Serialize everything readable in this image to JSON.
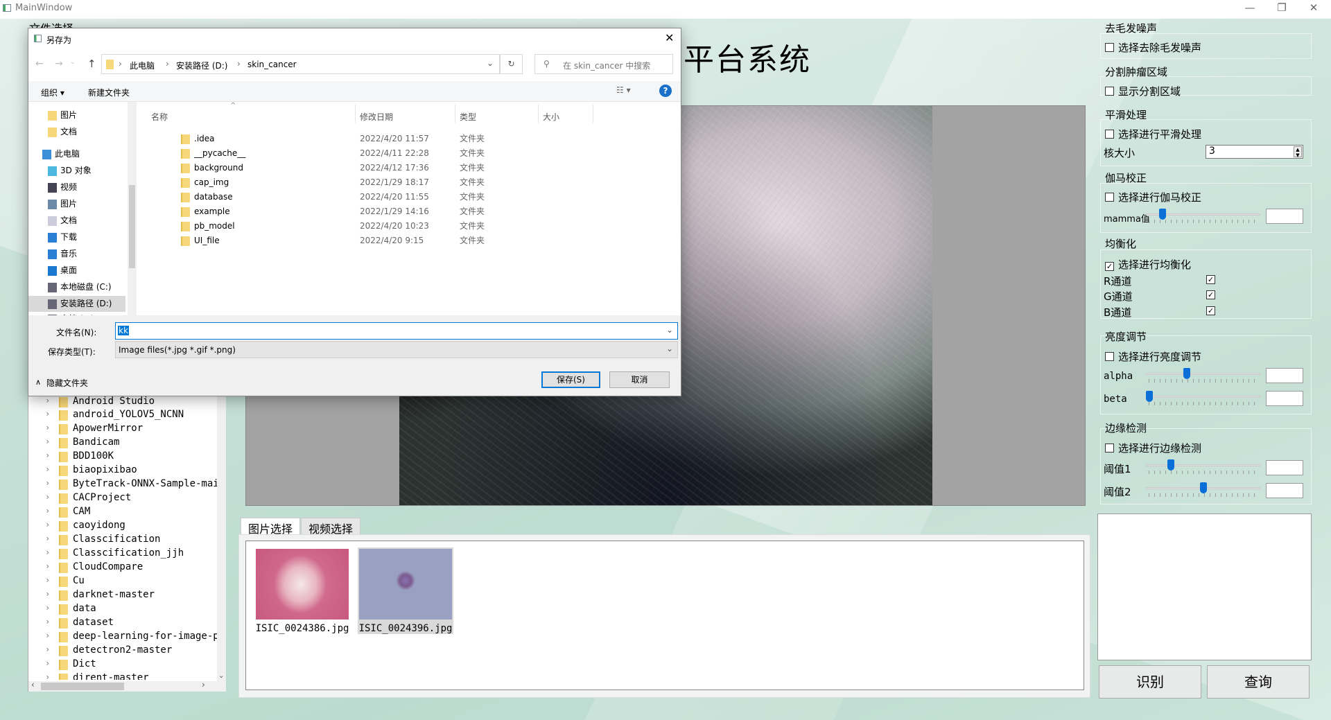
{
  "window": {
    "title": "MainWindow",
    "minimize": "—",
    "restore": "❐",
    "close": "✕"
  },
  "app": {
    "title_visible": "平台系统",
    "file_select_label": "文件选择",
    "tabs": [
      {
        "label": "图片选择",
        "active": true
      },
      {
        "label": "视频选择",
        "active": false
      }
    ],
    "thumbnails": [
      {
        "name": "ISIC_0024386.jpg",
        "selected": false
      },
      {
        "name": "ISIC_0024396.jpg",
        "selected": true
      }
    ],
    "tree_items": [
      "android_YOLOV5_NCNN",
      "ApowerMirror",
      "Bandicam",
      "BDD100K",
      "biaopixibao",
      "ByteTrack-ONNX-Sample-main",
      "CACProject",
      "CAM",
      "caoyidong",
      "Classcification",
      "Classcification_jjh",
      "CloudCompare",
      "Cu",
      "darknet-master",
      "data",
      "dataset",
      "deep-learning-for-image-processing",
      "detectron2-master",
      "Dict",
      "dirent-master"
    ],
    "tree_partial": "Android Studio",
    "buttons": {
      "recognize": "识别",
      "query": "查询"
    }
  },
  "right_panel": {
    "hair": {
      "title": "去毛发噪声",
      "checkbox": "选择去除毛发噪声",
      "checked": false
    },
    "segment": {
      "title": "分割肿瘤区域",
      "checkbox": "显示分割区域",
      "checked": false
    },
    "smooth": {
      "title": "平滑处理",
      "checkbox": "选择进行平滑处理",
      "checked": false,
      "kernel_label": "核大小",
      "kernel_value": "3"
    },
    "gamma": {
      "title": "伽马校正",
      "checkbox": "选择进行伽马校正",
      "checked": false,
      "slider_label": "mamma值",
      "slider_percent": 12,
      "value": ""
    },
    "equalize": {
      "title": "均衡化",
      "checkbox": "选择进行均衡化",
      "checked": true,
      "channels": [
        {
          "label": "R通道",
          "checked": true
        },
        {
          "label": "G通道",
          "checked": true
        },
        {
          "label": "B通道",
          "checked": true
        }
      ]
    },
    "brightness": {
      "title": "亮度调节",
      "checkbox": "选择进行亮度调节",
      "checked": false,
      "alpha_label": "alpha",
      "alpha_percent": 35,
      "alpha_value": "",
      "beta_label": "beta",
      "beta_percent": 0,
      "beta_value": ""
    },
    "edge": {
      "title": "边缘检测",
      "checkbox": "选择进行边缘检测",
      "checked": false,
      "t1_label": "阈值1",
      "t1_percent": 20,
      "t1_value": "",
      "t2_label": "阈值2",
      "t2_percent": 50,
      "t2_value": ""
    }
  },
  "dialog": {
    "title": "另存为",
    "close": "✕",
    "breadcrumb": [
      "此电脑",
      "安装路径 (D:)",
      "skin_cancer"
    ],
    "search_placeholder": "在 skin_cancer 中搜索",
    "toolbar": {
      "organize": "组织 ▾",
      "new_folder": "新建文件夹"
    },
    "nav_items": [
      {
        "label": "图片",
        "icon": "folder-icon",
        "indent": 1
      },
      {
        "label": "文档",
        "icon": "folder-icon",
        "indent": 1
      },
      {
        "label": "此电脑",
        "icon": "computer-icon",
        "indent": 0
      },
      {
        "label": "3D 对象",
        "icon": "cube-icon",
        "indent": 1
      },
      {
        "label": "视频",
        "icon": "video-icon",
        "indent": 1
      },
      {
        "label": "图片",
        "icon": "picture-icon",
        "indent": 1
      },
      {
        "label": "文档",
        "icon": "document-icon",
        "indent": 1
      },
      {
        "label": "下载",
        "icon": "download-icon",
        "indent": 1
      },
      {
        "label": "音乐",
        "icon": "music-icon",
        "indent": 1
      },
      {
        "label": "桌面",
        "icon": "desktop-icon",
        "indent": 1
      },
      {
        "label": "本地磁盘 (C:)",
        "icon": "drive-icon",
        "indent": 1
      },
      {
        "label": "安装路径 (D:)",
        "icon": "drive-icon",
        "indent": 1,
        "selected": true
      },
      {
        "label": "文档 (E:)",
        "icon": "drive-icon",
        "indent": 1
      }
    ],
    "columns": [
      "名称",
      "修改日期",
      "类型",
      "大小"
    ],
    "rows": [
      {
        "name": ".idea",
        "date": "2022/4/20 11:57",
        "type": "文件夹"
      },
      {
        "name": "__pycache__",
        "date": "2022/4/11 22:28",
        "type": "文件夹"
      },
      {
        "name": "background",
        "date": "2022/4/12 17:36",
        "type": "文件夹"
      },
      {
        "name": "cap_img",
        "date": "2022/1/29 18:17",
        "type": "文件夹"
      },
      {
        "name": "database",
        "date": "2022/4/20 11:55",
        "type": "文件夹"
      },
      {
        "name": "example",
        "date": "2022/1/29 14:16",
        "type": "文件夹"
      },
      {
        "name": "pb_model",
        "date": "2022/4/20 10:23",
        "type": "文件夹"
      },
      {
        "name": "UI_file",
        "date": "2022/4/20 9:15",
        "type": "文件夹"
      }
    ],
    "filename_label": "文件名(N):",
    "filename_value": "kk",
    "filetype_label": "保存类型(T):",
    "filetype_value": "Image files(*.jpg *.gif *.png)",
    "hide_folders": "隐藏文件夹",
    "save": "保存(S)",
    "cancel": "取消",
    "accent": "#0078d7"
  }
}
